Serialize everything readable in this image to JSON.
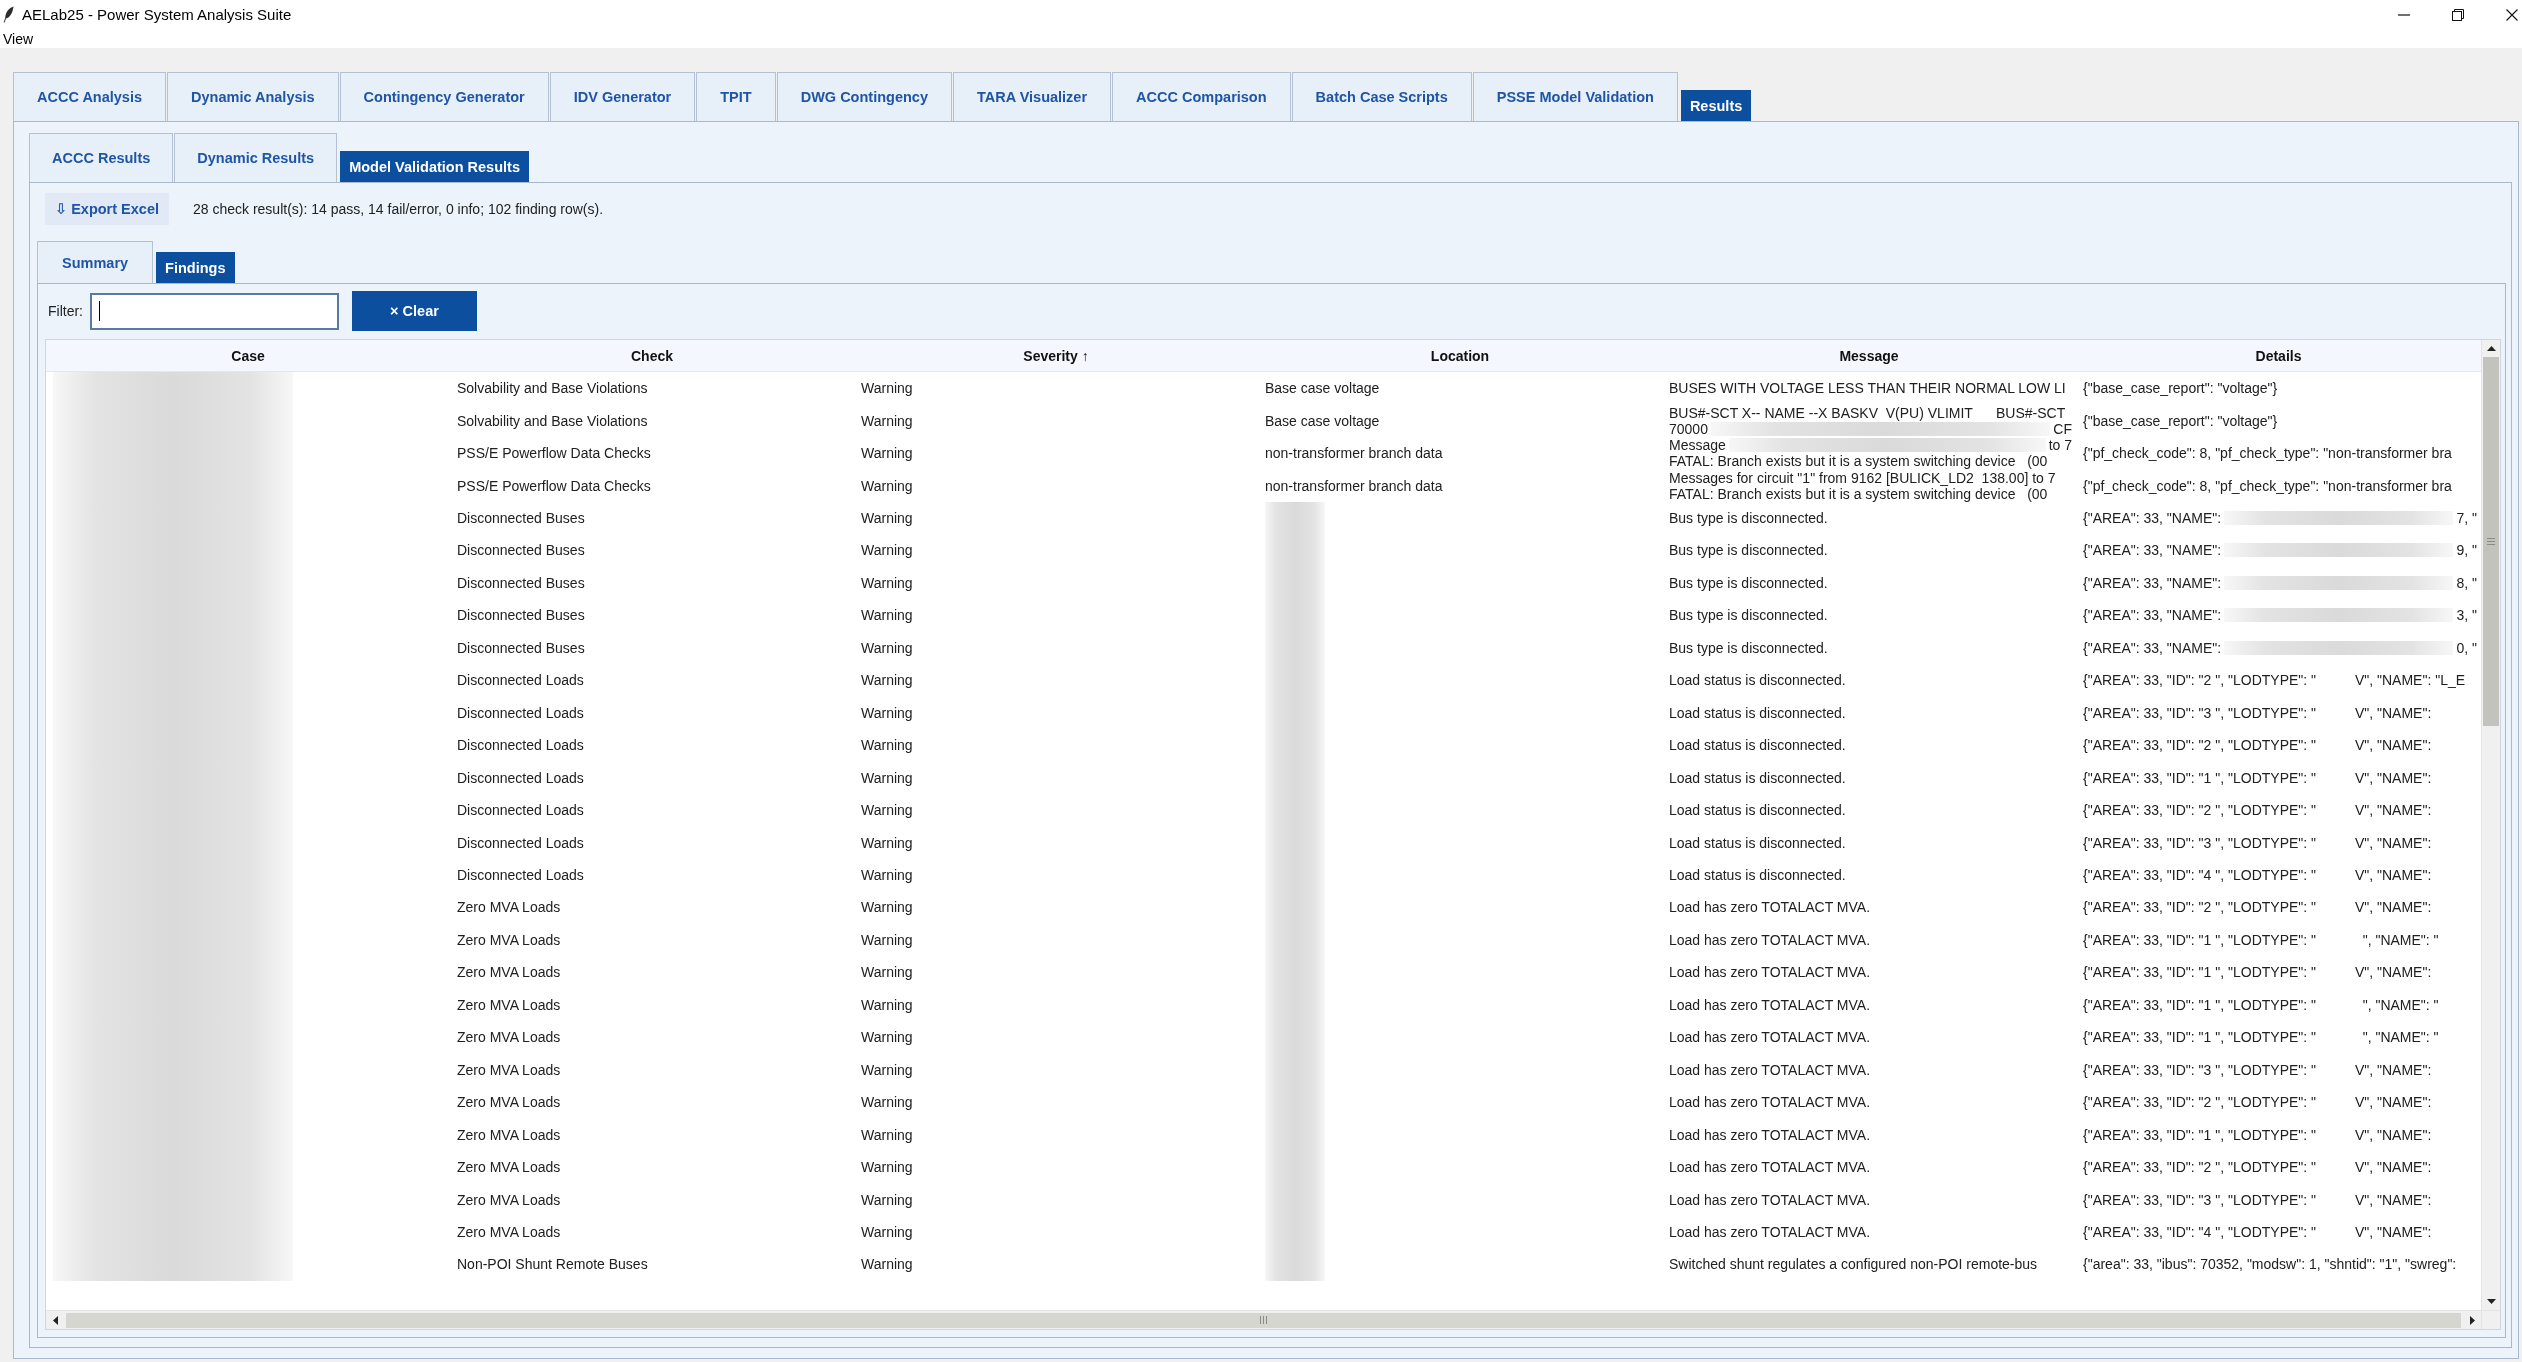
{
  "window": {
    "title": "AELab25 - Power System Analysis Suite"
  },
  "menu_bar": [
    "View"
  ],
  "main_tabs": [
    {
      "label": "ACCC Analysis",
      "selected": false
    },
    {
      "label": "Dynamic Analysis",
      "selected": false
    },
    {
      "label": "Contingency Generator",
      "selected": false
    },
    {
      "label": "IDV Generator",
      "selected": false
    },
    {
      "label": "TPIT",
      "selected": false
    },
    {
      "label": "DWG Contingency",
      "selected": false
    },
    {
      "label": "TARA Visualizer",
      "selected": false
    },
    {
      "label": "ACCC Comparison",
      "selected": false
    },
    {
      "label": "Batch Case Scripts",
      "selected": false
    },
    {
      "label": "PSSE Model Validation",
      "selected": false
    },
    {
      "label": "Results",
      "selected": true
    }
  ],
  "results_tabs": [
    {
      "label": "ACCC Results",
      "selected": false
    },
    {
      "label": "Dynamic Results",
      "selected": false
    },
    {
      "label": "Model Validation Results",
      "selected": true
    }
  ],
  "toolbar": {
    "export_button": "⇩ Export Excel",
    "summary": "28 check result(s): 14 pass, 14 fail/error, 0 info; 102 finding row(s)."
  },
  "view_tabs": [
    {
      "label": "Summary",
      "selected": false
    },
    {
      "label": "Findings",
      "selected": true
    }
  ],
  "filter": {
    "label": "Filter:",
    "clear_button": "× Clear"
  },
  "table": {
    "columns": [
      "Case",
      "Check",
      "Severity ↑",
      "Location",
      "Message",
      "Details"
    ],
    "rows": [
      {
        "check": "Solvability and Base Violations",
        "severity": "Warning",
        "location": "Base case voltage",
        "message": "BUSES WITH VOLTAGE LESS THAN THEIR NORMAL LOW LI",
        "details": "{\"base_case_report\": \"voltage\"}"
      },
      {
        "check": "Solvability and Base Violations",
        "severity": "Warning",
        "location": "Base case voltage",
        "message": [
          "BUS#-SCT X-- NAME --X BASKV  V(PU) VLIMIT      BUS#-SCT",
          [
            "70000",
            "CF"
          ]
        ],
        "details": "{\"base_case_report\": \"voltage\"}"
      },
      {
        "check": "PSS/E Powerflow Data Checks",
        "severity": "Warning",
        "location": "non-transformer branch data",
        "message": [
          [
            "Message",
            "to 7"
          ],
          "FATAL: Branch exists but it is a system switching device   (00"
        ],
        "details": "{\"pf_check_code\": 8, \"pf_check_type\": \"non-transformer bra"
      },
      {
        "check": "PSS/E Powerflow Data Checks",
        "severity": "Warning",
        "location": "non-transformer branch data",
        "message": [
          "Messages for circuit \"1\" from 9162 [BULICK_LD2  138.00] to 7",
          "FATAL: Branch exists but it is a system switching device   (00"
        ],
        "details": "{\"pf_check_code\": 8, \"pf_check_type\": \"non-transformer bra"
      },
      {
        "check": "Disconnected Buses",
        "severity": "Warning",
        "message": "Bus type is disconnected.",
        "details": [
          [
            "{\"AREA\": 33, \"NAME\":",
            "7, \""
          ]
        ]
      },
      {
        "check": "Disconnected Buses",
        "severity": "Warning",
        "message": "Bus type is disconnected.",
        "details": [
          [
            "{\"AREA\": 33, \"NAME\":",
            "9, \""
          ]
        ]
      },
      {
        "check": "Disconnected Buses",
        "severity": "Warning",
        "message": "Bus type is disconnected.",
        "details": [
          [
            "{\"AREA\": 33, \"NAME\":",
            "8, \""
          ]
        ]
      },
      {
        "check": "Disconnected Buses",
        "severity": "Warning",
        "message": "Bus type is disconnected.",
        "details": [
          [
            "{\"AREA\": 33, \"NAME\":",
            "3, \""
          ]
        ]
      },
      {
        "check": "Disconnected Buses",
        "severity": "Warning",
        "message": "Bus type is disconnected.",
        "details": [
          [
            "{\"AREA\": 33, \"NAME\":",
            "0, \""
          ]
        ]
      },
      {
        "check": "Disconnected Loads",
        "severity": "Warning",
        "message": "Load status is disconnected.",
        "details": "{\"AREA\": 33, \"ID\": \"2 \", \"LODTYPE\": \"          V\", \"NAME\": \"L_E"
      },
      {
        "check": "Disconnected Loads",
        "severity": "Warning",
        "message": "Load status is disconnected.",
        "details": "{\"AREA\": 33, \"ID\": \"3 \", \"LODTYPE\": \"          V\", \"NAME\":"
      },
      {
        "check": "Disconnected Loads",
        "severity": "Warning",
        "message": "Load status is disconnected.",
        "details": "{\"AREA\": 33, \"ID\": \"2 \", \"LODTYPE\": \"          V\", \"NAME\":"
      },
      {
        "check": "Disconnected Loads",
        "severity": "Warning",
        "message": "Load status is disconnected.",
        "details": "{\"AREA\": 33, \"ID\": \"1 \", \"LODTYPE\": \"          V\", \"NAME\":"
      },
      {
        "check": "Disconnected Loads",
        "severity": "Warning",
        "message": "Load status is disconnected.",
        "details": "{\"AREA\": 33, \"ID\": \"2 \", \"LODTYPE\": \"          V\", \"NAME\":"
      },
      {
        "check": "Disconnected Loads",
        "severity": "Warning",
        "message": "Load status is disconnected.",
        "details": "{\"AREA\": 33, \"ID\": \"3 \", \"LODTYPE\": \"          V\", \"NAME\":"
      },
      {
        "check": "Disconnected Loads",
        "severity": "Warning",
        "message": "Load status is disconnected.",
        "details": "{\"AREA\": 33, \"ID\": \"4 \", \"LODTYPE\": \"          V\", \"NAME\":"
      },
      {
        "check": "Zero MVA Loads",
        "severity": "Warning",
        "message": "Load has zero TOTALACT MVA.",
        "details": "{\"AREA\": 33, \"ID\": \"2 \", \"LODTYPE\": \"          V\", \"NAME\":"
      },
      {
        "check": "Zero MVA Loads",
        "severity": "Warning",
        "message": "Load has zero TOTALACT MVA.",
        "details": "{\"AREA\": 33, \"ID\": \"1 \", \"LODTYPE\": \"            \", \"NAME\": \""
      },
      {
        "check": "Zero MVA Loads",
        "severity": "Warning",
        "message": "Load has zero TOTALACT MVA.",
        "details": "{\"AREA\": 33, \"ID\": \"1 \", \"LODTYPE\": \"          V\", \"NAME\":"
      },
      {
        "check": "Zero MVA Loads",
        "severity": "Warning",
        "message": "Load has zero TOTALACT MVA.",
        "details": "{\"AREA\": 33, \"ID\": \"1 \", \"LODTYPE\": \"            \", \"NAME\": \""
      },
      {
        "check": "Zero MVA Loads",
        "severity": "Warning",
        "message": "Load has zero TOTALACT MVA.",
        "details": "{\"AREA\": 33, \"ID\": \"1 \", \"LODTYPE\": \"            \", \"NAME\": \""
      },
      {
        "check": "Zero MVA Loads",
        "severity": "Warning",
        "message": "Load has zero TOTALACT MVA.",
        "details": "{\"AREA\": 33, \"ID\": \"3 \", \"LODTYPE\": \"          V\", \"NAME\":"
      },
      {
        "check": "Zero MVA Loads",
        "severity": "Warning",
        "message": "Load has zero TOTALACT MVA.",
        "details": "{\"AREA\": 33, \"ID\": \"2 \", \"LODTYPE\": \"          V\", \"NAME\":"
      },
      {
        "check": "Zero MVA Loads",
        "severity": "Warning",
        "message": "Load has zero TOTALACT MVA.",
        "details": "{\"AREA\": 33, \"ID\": \"1 \", \"LODTYPE\": \"          V\", \"NAME\":"
      },
      {
        "check": "Zero MVA Loads",
        "severity": "Warning",
        "message": "Load has zero TOTALACT MVA.",
        "details": "{\"AREA\": 33, \"ID\": \"2 \", \"LODTYPE\": \"          V\", \"NAME\":"
      },
      {
        "check": "Zero MVA Loads",
        "severity": "Warning",
        "message": "Load has zero TOTALACT MVA.",
        "details": "{\"AREA\": 33, \"ID\": \"3 \", \"LODTYPE\": \"          V\", \"NAME\":"
      },
      {
        "check": "Zero MVA Loads",
        "severity": "Warning",
        "message": "Load has zero TOTALACT MVA.",
        "details": "{\"AREA\": 33, \"ID\": \"4 \", \"LODTYPE\": \"          V\", \"NAME\":"
      },
      {
        "check": "Non-POI Shunt Remote Buses",
        "severity": "Warning",
        "message": "Switched shunt regulates a configured non-POI remote-bus",
        "details": "{\"area\": 33, \"ibus\": 70352, \"modsw\": 1, \"shntid\": \"1\", \"swreg\":"
      }
    ]
  }
}
